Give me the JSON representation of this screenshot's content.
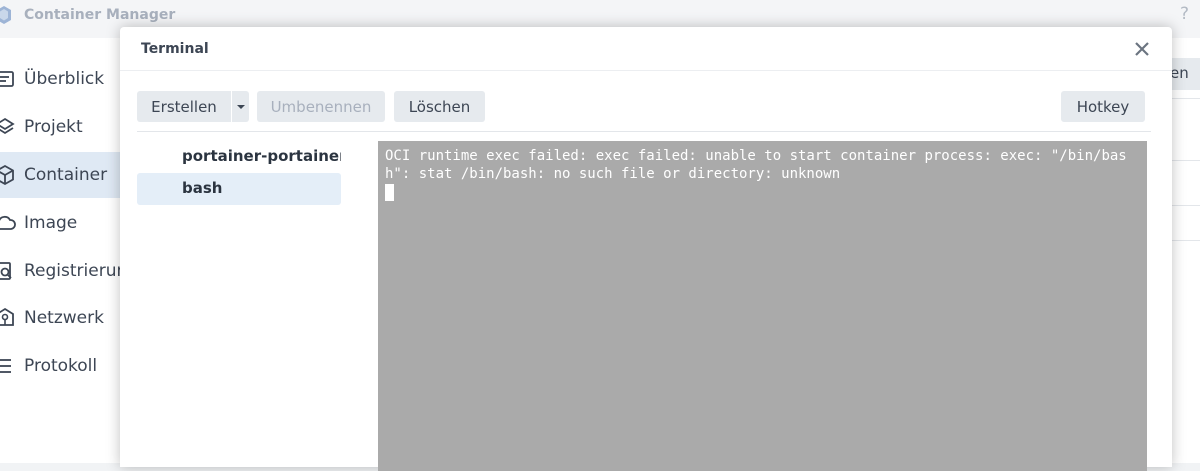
{
  "app": {
    "title": "Container Manager",
    "help_label": "?",
    "right_partial_text": "en"
  },
  "sidebar": {
    "items": [
      {
        "label": "Überblick",
        "icon": "overview-icon",
        "active": false
      },
      {
        "label": "Projekt",
        "icon": "project-icon",
        "active": false
      },
      {
        "label": "Container",
        "icon": "container-icon",
        "active": true
      },
      {
        "label": "Image",
        "icon": "image-icon",
        "active": false
      },
      {
        "label": "Registrierun",
        "icon": "registry-icon",
        "active": false
      },
      {
        "label": "Netzwerk",
        "icon": "network-icon",
        "active": false
      },
      {
        "label": "Protokoll",
        "icon": "log-icon",
        "active": false
      }
    ]
  },
  "dialog": {
    "title": "Terminal",
    "toolbar": {
      "create_label": "Erstellen",
      "rename_label": "Umbenennen",
      "delete_label": "Löschen",
      "hotkey_label": "Hotkey"
    },
    "sessions": [
      {
        "label": "portainer-portainer",
        "active": false
      },
      {
        "label": "bash",
        "active": true
      }
    ],
    "terminal": {
      "output": "OCI runtime exec failed: exec failed: unable to start container process: exec: \"/bin/bash\": stat /bin/bash: no such file or directory: unknown"
    }
  },
  "colors": {
    "accent_active": "#dfe9f4",
    "terminal_bg": "#aaaaaa",
    "button_bg": "#e6eaee"
  }
}
